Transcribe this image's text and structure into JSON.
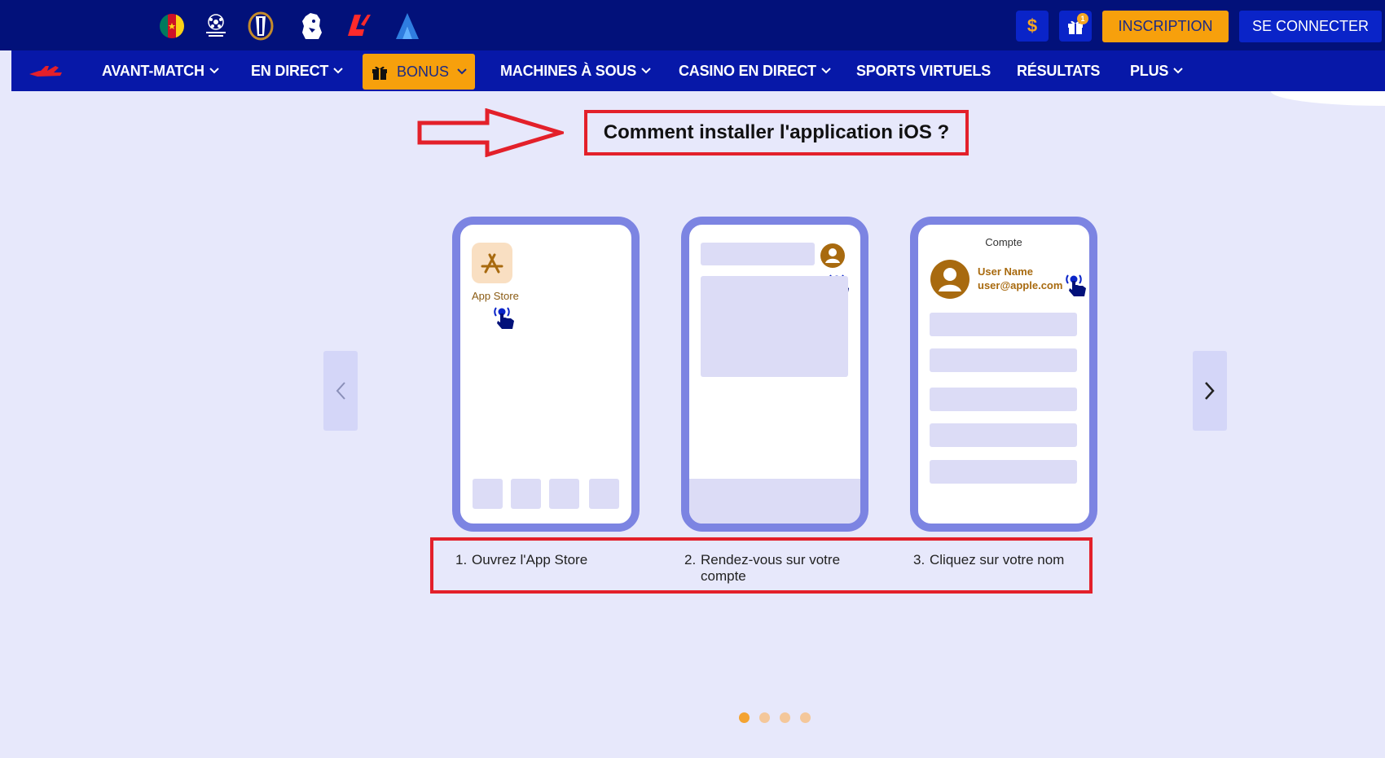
{
  "header": {
    "leagues": [
      "cameroon-flag-icon",
      "champions-league-icon",
      "europa-league-icon",
      "premier-league-icon",
      "laliga-icon",
      "serie-a-icon"
    ],
    "dollar_symbol": "$",
    "gift_badge": "1",
    "register_label": "INSCRIPTION",
    "login_label": "SE CONNECTER"
  },
  "nav": {
    "items": [
      {
        "label": "AVANT-MATCH",
        "has_dropdown": true
      },
      {
        "label": "EN DIRECT",
        "has_dropdown": true
      },
      {
        "label": "BONUS",
        "has_dropdown": true
      },
      {
        "label": "MACHINES À SOUS",
        "has_dropdown": true
      },
      {
        "label": "CASINO EN DIRECT",
        "has_dropdown": true
      },
      {
        "label": "SPORTS VIRTUELS",
        "has_dropdown": false
      },
      {
        "label": "RÉSULTATS",
        "has_dropdown": false
      },
      {
        "label": "PLUS",
        "has_dropdown": true
      }
    ]
  },
  "main": {
    "heading": "Comment installer l'application iOS ?",
    "phone1": {
      "app_label": "App Store"
    },
    "phone3": {
      "title": "Compte",
      "user_name": "User Name",
      "user_email": "user@apple.com"
    },
    "steps": [
      {
        "num": "1.",
        "text": "Ouvrez l'App Store"
      },
      {
        "num": "2.",
        "text": "Rendez-vous sur votre compte"
      },
      {
        "num": "3.",
        "text": "Cliquez sur votre nom"
      }
    ],
    "pagination": {
      "total": 4,
      "active": 1
    }
  },
  "colors": {
    "header_bg": "#02117a",
    "nav_bg": "#0718a8",
    "accent_orange": "#f7a00c",
    "highlight_red": "#e3202a",
    "phone_frame": "#7c84e2",
    "page_bg": "#e7e8fb"
  }
}
